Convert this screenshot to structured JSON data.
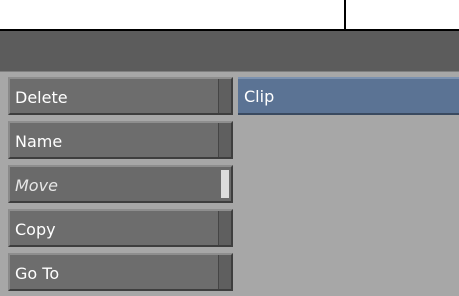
{
  "panel": {
    "field": {
      "value": "Clip"
    },
    "buttons": [
      {
        "label": "Delete",
        "enabled": true
      },
      {
        "label": "Name",
        "enabled": true
      },
      {
        "label": "Move",
        "enabled": false
      },
      {
        "label": "Copy",
        "enabled": true
      },
      {
        "label": "Go To",
        "enabled": true
      }
    ]
  },
  "colors": {
    "panel_background": "#a7a7a7",
    "header_bar": "#5c5c5c",
    "button_face": "#6d6d6d",
    "field_highlight": "#5b7394"
  }
}
